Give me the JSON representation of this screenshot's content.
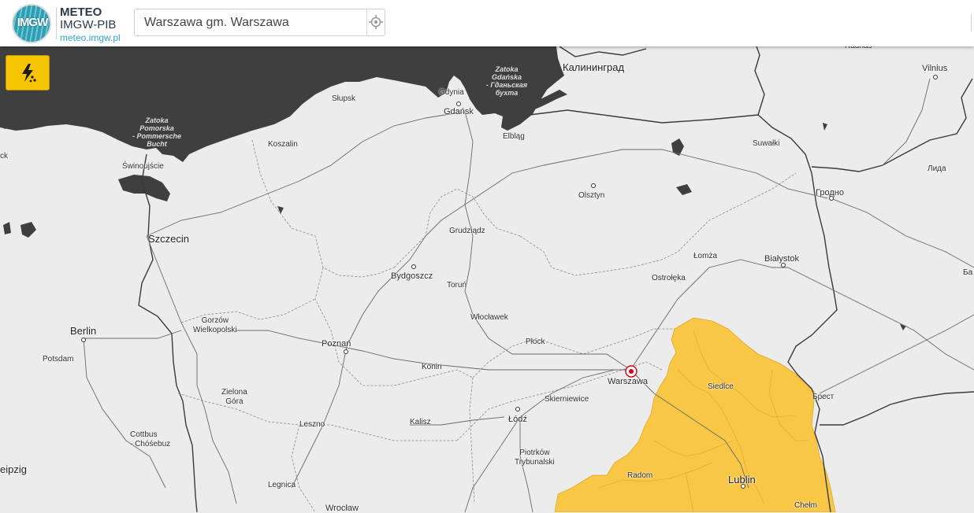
{
  "header": {
    "logo_text": "IMGW",
    "brand_title": "METEO",
    "brand_subtitle": "IMGW-PIB",
    "brand_url": "meteo.imgw.pl",
    "search_value": "Warszawa gm. Warszawa"
  },
  "toolbar": {
    "warning_icon": "lightning-rain-icon",
    "warning_color": "#f6c400"
  },
  "map": {
    "colors": {
      "land": "#ececec",
      "sea": "#3f3f3f",
      "warning_area": "#f9c746",
      "border": "#3a3a3a"
    },
    "selected_location": "Warszawa",
    "seas": [
      {
        "name": "Zatoka\nPomorska\n- Pommersche\nBucht"
      },
      {
        "name": "Zatoka\nGdańska\n- Гданьская\nбухта"
      }
    ],
    "cities": [
      {
        "name": "Słupsk"
      },
      {
        "name": "Gdynia"
      },
      {
        "name": "Gdańsk"
      },
      {
        "name": "Калининград"
      },
      {
        "name": "Elbląg"
      },
      {
        "name": "Koszalin"
      },
      {
        "name": "Świnoujście"
      },
      {
        "name": "Szczecin"
      },
      {
        "name": "Olsztyn"
      },
      {
        "name": "Suwałki"
      },
      {
        "name": "Vilnius"
      },
      {
        "name": "Гродно"
      },
      {
        "name": "Лида"
      },
      {
        "name": "Grudziądz"
      },
      {
        "name": "Łomża"
      },
      {
        "name": "Białystok"
      },
      {
        "name": "Bydgoszcz"
      },
      {
        "name": "Toruń"
      },
      {
        "name": "Ostrołęka"
      },
      {
        "name": "Włocławek"
      },
      {
        "name": "Płock"
      },
      {
        "name": "Berlin"
      },
      {
        "name": "Potsdam"
      },
      {
        "name": "Gorzów\nWielkopolski"
      },
      {
        "name": "Poznań"
      },
      {
        "name": "Konin"
      },
      {
        "name": "Warszawa"
      },
      {
        "name": "Siedlce"
      },
      {
        "name": "Брест"
      },
      {
        "name": "Skierniewice"
      },
      {
        "name": "Zielona\nGóra"
      },
      {
        "name": "Leszno"
      },
      {
        "name": "Kalisz"
      },
      {
        "name": "Łódź"
      },
      {
        "name": "Cottbus\n- Chóśebuz"
      },
      {
        "name": "Piotrków\nTrybunalski"
      },
      {
        "name": "Radom"
      },
      {
        "name": "Lublin"
      },
      {
        "name": "Legnica"
      },
      {
        "name": "Wrocław"
      },
      {
        "name": "Chełm"
      },
      {
        "name": "eipzig"
      },
      {
        "name": "ck"
      },
      {
        "name": "Radnas"
      },
      {
        "name": "Ба"
      }
    ]
  }
}
